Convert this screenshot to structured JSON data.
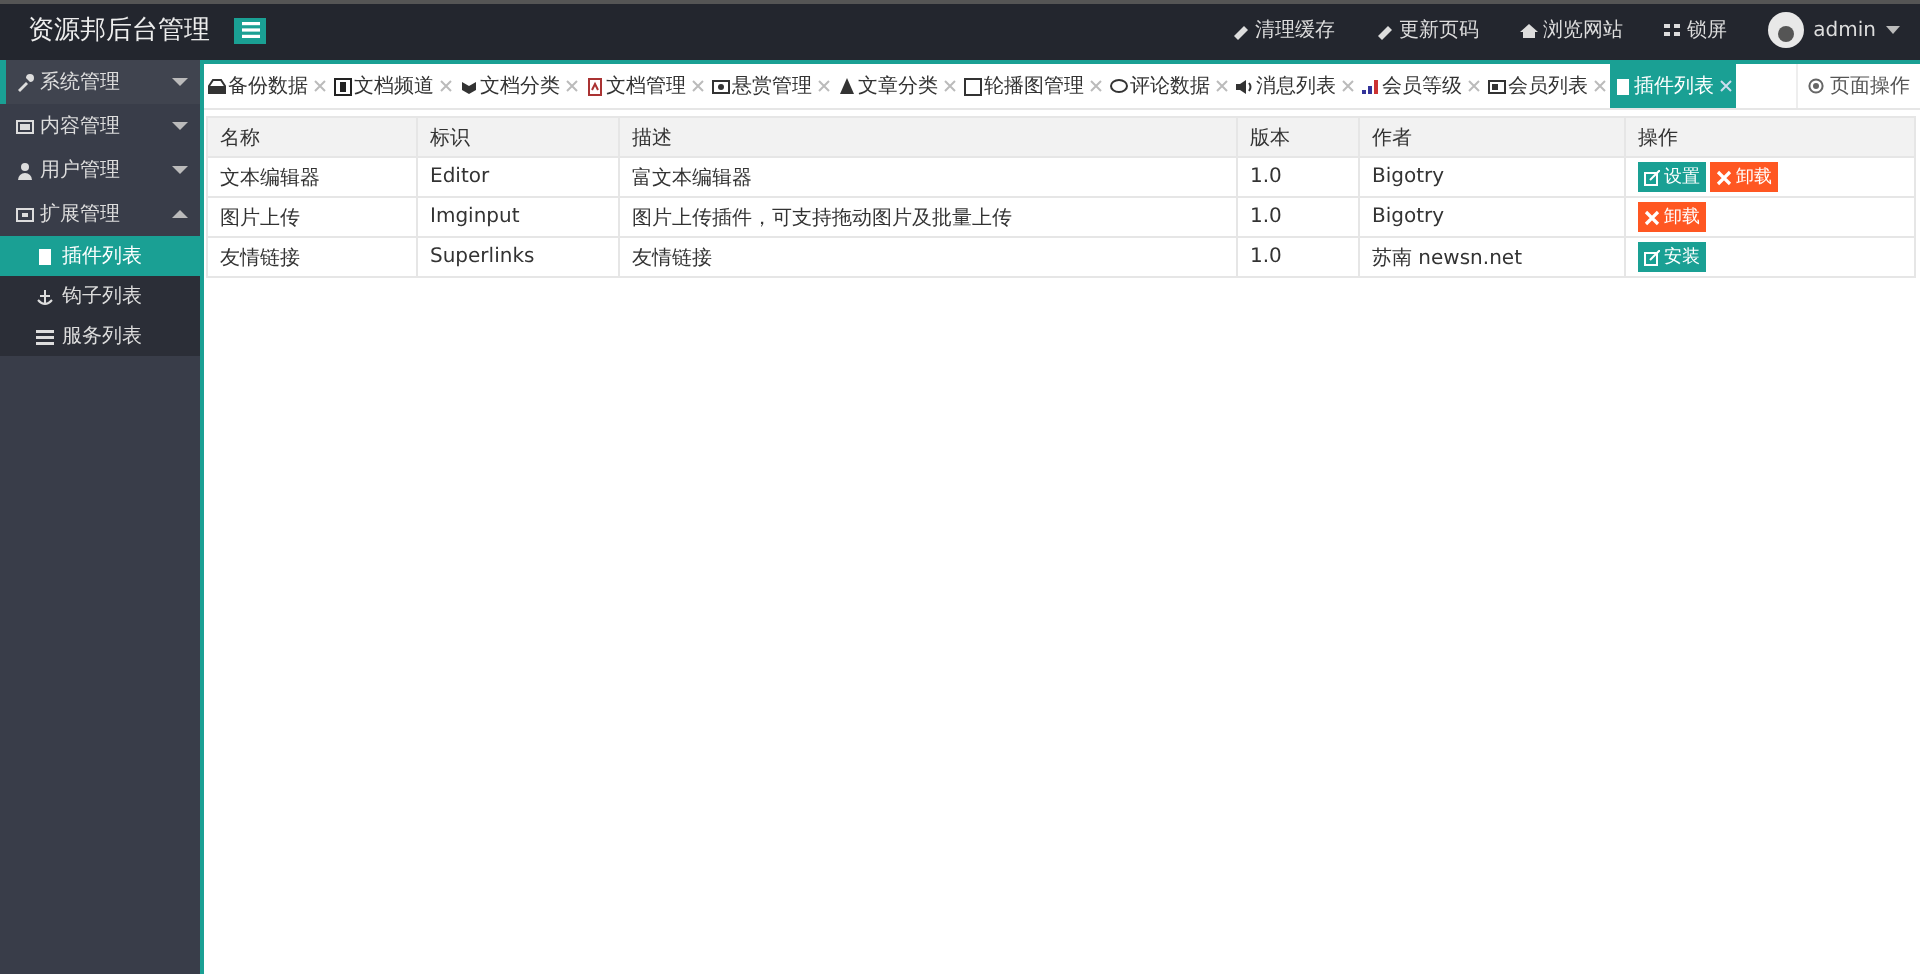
{
  "header": {
    "title": "资源邦后台管理",
    "actions": [
      {
        "label": "清理缓存"
      },
      {
        "label": "更新页码"
      },
      {
        "label": "浏览网站"
      },
      {
        "label": "锁屏"
      }
    ],
    "user": "admin"
  },
  "sidebar": {
    "items": [
      {
        "label": "系统管理",
        "expanded": false
      },
      {
        "label": "内容管理",
        "expanded": false
      },
      {
        "label": "用户管理",
        "expanded": false
      },
      {
        "label": "扩展管理",
        "expanded": true,
        "children": [
          {
            "label": "插件列表",
            "selected": true
          },
          {
            "label": "钩子列表",
            "selected": false
          },
          {
            "label": "服务列表",
            "selected": false
          }
        ]
      }
    ]
  },
  "tabs": [
    {
      "label": "备份数据",
      "selected": false
    },
    {
      "label": "文档频道",
      "selected": false
    },
    {
      "label": "文档分类",
      "selected": false
    },
    {
      "label": "文档管理",
      "selected": false
    },
    {
      "label": "悬赏管理",
      "selected": false
    },
    {
      "label": "文章分类",
      "selected": false
    },
    {
      "label": "轮播图管理",
      "selected": false
    },
    {
      "label": "评论数据",
      "selected": false
    },
    {
      "label": "消息列表",
      "selected": false
    },
    {
      "label": "会员等级",
      "selected": false
    },
    {
      "label": "会员列表",
      "selected": false
    },
    {
      "label": "插件列表",
      "selected": true
    }
  ],
  "page_actions": "页面操作",
  "table": {
    "columns": [
      "名称",
      "标识",
      "描述",
      "版本",
      "作者",
      "操作"
    ],
    "rows": [
      {
        "cells": [
          "文本编辑器",
          "Editor",
          "富文本编辑器",
          "1.0",
          "Bigotry"
        ],
        "actions": [
          {
            "label": "设置",
            "kind": "primary"
          },
          {
            "label": "卸载",
            "kind": "danger"
          }
        ]
      },
      {
        "cells": [
          "图片上传",
          "Imginput",
          "图片上传插件，可支持拖动图片及批量上传",
          "1.0",
          "Bigotry"
        ],
        "actions": [
          {
            "label": "卸载",
            "kind": "danger"
          }
        ]
      },
      {
        "cells": [
          "友情链接",
          "Superlinks",
          "友情链接",
          "1.0",
          "苏南 newsn.net"
        ],
        "actions": [
          {
            "label": "安装",
            "kind": "primary"
          }
        ]
      }
    ]
  }
}
